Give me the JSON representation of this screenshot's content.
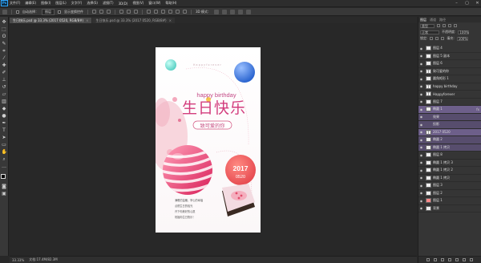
{
  "app": {
    "logo": "Ps"
  },
  "menu": [
    "文件(F)",
    "编辑(E)",
    "图像(I)",
    "图层(L)",
    "文字(Y)",
    "选择(S)",
    "滤镜(T)",
    "3D(D)",
    "视图(V)",
    "窗口(W)",
    "帮助(H)"
  ],
  "window_controls": {
    "minimize": "–",
    "maximize": "▢",
    "close": "✕"
  },
  "options": {
    "auto_select": "自动选择：",
    "target": "图层",
    "transform": "显示变换控件",
    "mode_3d": "3D 模式："
  },
  "tabs": [
    {
      "label": "生日快乐.psd @ 33.3% (2017 0520, RGB/8#)",
      "close": "×"
    },
    {
      "label": "生日快乐.psd @ 33.3% (2017 0520, RGB/8#)",
      "close": "×"
    }
  ],
  "status": {
    "zoom": "33.33%",
    "doc": "文档:17.4M/82.3M"
  },
  "panel": {
    "tabs": [
      "图层",
      "通道",
      "路径"
    ],
    "filter_kind": "类型",
    "blend": "正常",
    "opacity_label": "不透明度:",
    "opacity": "100%",
    "lock_label": "锁定:",
    "fill_label": "填充:",
    "fill": "100%",
    "layers": [
      {
        "name": "图层 4",
        "thumb": "",
        "fx": ""
      },
      {
        "name": "图层 5 副本",
        "thumb": "",
        "fx": ""
      },
      {
        "name": "图层 6",
        "thumb": "",
        "fx": ""
      },
      {
        "name": "致可爱的你",
        "thumb": "T",
        "fx": ""
      },
      {
        "name": "圆角矩形 1",
        "thumb": "",
        "fx": ""
      },
      {
        "name": "happy birthday",
        "thumb": "T",
        "fx": ""
      },
      {
        "name": "Happyforever",
        "thumb": "T",
        "fx": ""
      },
      {
        "name": "图层 7",
        "thumb": "",
        "fx": ""
      },
      {
        "name": "椭圆 1",
        "thumb": "",
        "fx": "fx"
      },
      {
        "name": "效果",
        "thumb": "",
        "fx": ""
      },
      {
        "name": "投影",
        "thumb": "",
        "fx": ""
      },
      {
        "name": "2017 0520",
        "thumb": "T",
        "fx": ""
      },
      {
        "name": "椭圆 2",
        "thumb": "",
        "fx": ""
      },
      {
        "name": "椭圆 1 拷贝",
        "thumb": "",
        "fx": ""
      },
      {
        "name": "图层 8",
        "thumb": "",
        "fx": ""
      },
      {
        "name": "椭圆 1 拷贝 3",
        "thumb": "",
        "fx": ""
      },
      {
        "name": "椭圆 1 拷贝 2",
        "thumb": "",
        "fx": ""
      },
      {
        "name": "椭圆 1 拷贝",
        "thumb": "",
        "fx": ""
      },
      {
        "name": "图层 3",
        "thumb": "",
        "fx": ""
      },
      {
        "name": "图层 2",
        "thumb": "",
        "fx": ""
      },
      {
        "name": "图层 1",
        "thumb": "",
        "fx": ""
      },
      {
        "name": "背景",
        "thumb": "",
        "fx": ""
      }
    ]
  },
  "poster": {
    "top_script": "Happyforever",
    "happy_birthday": "happy birthday",
    "title": "生日快乐",
    "subtitle": "致可爱的你",
    "year": "2017",
    "date": "0520",
    "poem_lines": [
      "满眼的温暖，掌心的幸福",
      "点燃生日的烛光",
      "许下你美好的心愿",
      "祝福你生日快乐！"
    ]
  },
  "colors": {
    "accent": "#e0457b",
    "purple": "#6d5f8a",
    "teal": "#7fd9d0",
    "blue": "#3a7ad9"
  }
}
